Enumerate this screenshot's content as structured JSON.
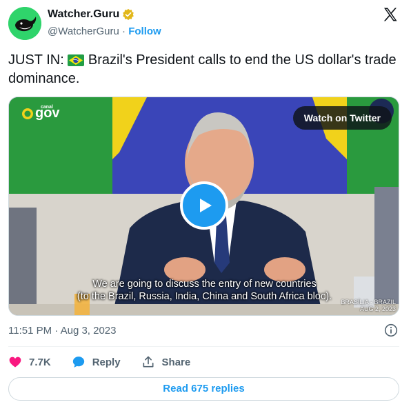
{
  "author": {
    "display_name": "Watcher.Guru",
    "handle": "@WatcherGuru",
    "separator": "·",
    "follow_label": "Follow",
    "avatar_color": "#2fd46b",
    "verified_color": "#e2b719"
  },
  "tweet": {
    "text_prefix": "JUST IN:",
    "text_body": "Brazil's President calls to end the US dollar's trade dominance."
  },
  "media": {
    "watch_label": "Watch on Twitter",
    "brand_small": "canal",
    "brand": "gov",
    "caption_line1": "We are going to discuss the entry of new countries",
    "caption_line2": "(to the Brazil, Russia, India, China and South Africa bloc).",
    "place_line1": "BRASÍLIA - BRAZIL",
    "place_line2": "AUG 2, 2023",
    "play_icon": "play-icon"
  },
  "meta": {
    "timestamp": "11:51 PM · Aug 3, 2023"
  },
  "actions": {
    "like_count": "7.7K",
    "reply_label": "Reply",
    "share_label": "Share",
    "like_color": "#f91880",
    "reply_color": "#1d9bf0"
  },
  "replies": {
    "label": "Read 675 replies"
  },
  "colors": {
    "accent": "#1d9bf0",
    "secondary_text": "#536471",
    "border": "#cfd9de"
  }
}
